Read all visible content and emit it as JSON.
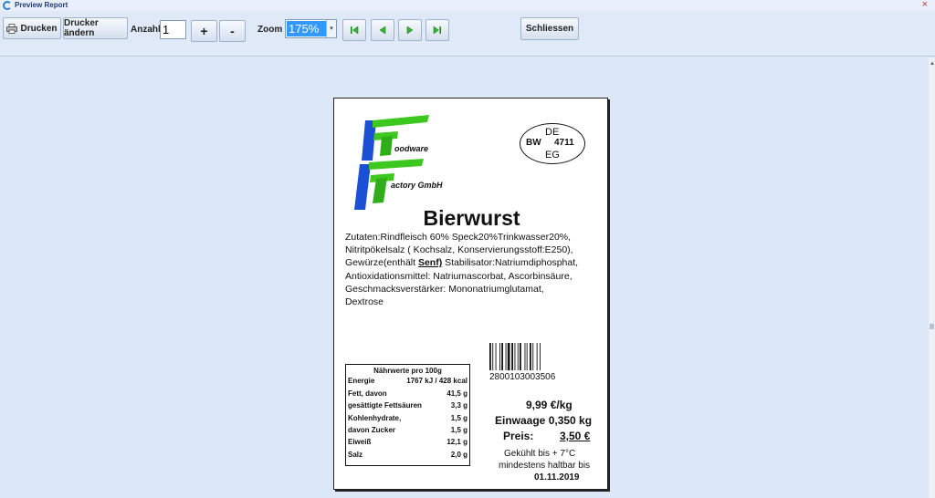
{
  "window": {
    "title": "Preview Report"
  },
  "toolbar": {
    "print_label": "Drucken",
    "change_printer_label": "Drucker ändern",
    "count_label": "Anzahl",
    "count_value": "1",
    "plus_label": "+",
    "minus_label": "-",
    "zoom_label": "Zoom",
    "zoom_value": "175%",
    "close_label": "Schliessen"
  },
  "label": {
    "logo_line1": "oodware",
    "logo_line2": "actory GmbH",
    "stamp": {
      "top": "DE",
      "left": "BW",
      "right": "4711",
      "bottom": "EG"
    },
    "product_name": "Bierwurst",
    "ingredients": {
      "line1": "Zutaten:Rindfleisch 60% Speck20%Trinkwasser20%,",
      "line2": "Nitritpökelsalz ( Kochsalz, Konservierungsstoff:E250),",
      "line3_pre": "Gewürze(enthält ",
      "line3_allergen": "Senf)",
      "line3_post": " Stabilisator:Natriumdiphosphat,",
      "line4": "Antioxidationsmittel: Natriumascorbat, Ascorbinsäure,",
      "line5": "Geschmacksverstärker: Mononatriumglutamat,",
      "line6": "Dextrose"
    },
    "nutrition": {
      "header": "Nährwerte pro 100g",
      "rows": [
        {
          "name": "Energie",
          "value": "1767 kJ / 428 kcal"
        },
        {
          "name": "Fett, davon",
          "value": "41,5 g"
        },
        {
          "name": "gesättigte Fettsäuren",
          "value": "3,3 g"
        },
        {
          "name": "Kohlenhydrate,",
          "value": "1,5 g"
        },
        {
          "name": "davon Zucker",
          "value": "1,5 g"
        },
        {
          "name": "Eiweiß",
          "value": "12,1 g"
        },
        {
          "name": "Salz",
          "value": "2,0 g"
        }
      ]
    },
    "barcode_number": "2800103003506",
    "price_per_kg": "9,99 €/kg",
    "weight": "Einwaage  0,350 kg",
    "price_label": "Preis:",
    "price_value": "3,50 €",
    "storage": "Gekühlt bis + 7°C",
    "best_before_label": "mindestens haltbar bis",
    "best_before_date": "01.11.2019"
  },
  "colors": {
    "logo_blue": "#1a4fd6",
    "logo_green": "#3cc81e",
    "toolbar_bg": "#dfe9f8",
    "zoom_highlight": "#3399ff"
  }
}
